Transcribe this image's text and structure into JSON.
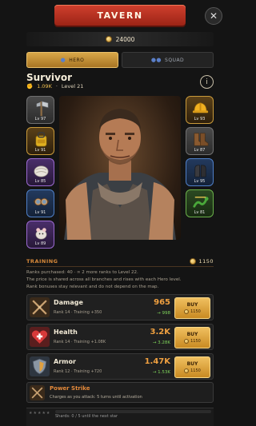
{
  "header": {
    "title": "TAVERN",
    "close_symbol": "✕"
  },
  "currency": {
    "amount": "24000",
    "icon": "coin-icon"
  },
  "tabs": [
    {
      "label": "HERO",
      "icon": "person-icon",
      "active": true
    },
    {
      "label": "SQUAD",
      "icon": "group-icon",
      "active": false
    }
  ],
  "hero": {
    "name": "Survivor",
    "power": "1.09K",
    "level": "Level 21",
    "info_symbol": "i"
  },
  "equipment": {
    "left": [
      {
        "icon": "axe-icon",
        "level": "Lv 97",
        "rarity": "gray"
      },
      {
        "icon": "backpack-icon",
        "level": "Lv 91",
        "rarity": "gold"
      },
      {
        "icon": "bandage-icon",
        "level": "Lv 85",
        "rarity": "purple"
      },
      {
        "icon": "goggles-icon",
        "level": "Lv 91",
        "rarity": "blue"
      },
      {
        "icon": "rat-icon",
        "level": "Lv 89",
        "rarity": "purple"
      }
    ],
    "right": [
      {
        "icon": "hardhat-icon",
        "level": "Lv 93",
        "rarity": "gold"
      },
      {
        "icon": "boots-icon",
        "level": "Lv 87",
        "rarity": "gray"
      },
      {
        "icon": "gloves-icon",
        "level": "Lv 95",
        "rarity": "blue"
      },
      {
        "icon": "snake-icon",
        "level": "Lv 81",
        "rarity": "green"
      }
    ]
  },
  "training": {
    "heading": "TRAINING",
    "cost": "1150",
    "info_line": "Ranks purchased: 40 · ∞ 2 more ranks to Level 22.",
    "desc_1": "The price is shared across all branches and rises with each Hero level.",
    "desc_2": "Rank bonuses stay relevant and do not depend on the map.",
    "stats": [
      {
        "name": "Damage",
        "rank": "Rank 14 · Training +350",
        "value": "965",
        "next": "→ 998",
        "buy_label": "BUY",
        "buy_cost": "1150",
        "icon": "crossed-swords-icon"
      },
      {
        "name": "Health",
        "rank": "Rank 14 · Training +1.08K",
        "value": "3.2K",
        "next": "→ 3.28K",
        "buy_label": "BUY",
        "buy_cost": "1150",
        "icon": "heart-icon"
      },
      {
        "name": "Armor",
        "rank": "Rank 12 · Training +720",
        "value": "1.47K",
        "next": "→ 1.53K",
        "buy_label": "BUY",
        "buy_cost": "1150",
        "icon": "shield-icon"
      }
    ]
  },
  "power_strike": {
    "name": "Power Strike",
    "desc": "Charges as you attack: 5 turns until activation",
    "icon": "crossed-blades-icon"
  },
  "shards": {
    "stars": "★★★★★",
    "text": "Shards: 0 / 5 until the next star"
  },
  "colors": {
    "accent": "#d8a748",
    "ribbon": "#c0392b",
    "value": "#f0a040",
    "next": "#7ed25a",
    "training": "#d98a3a"
  }
}
